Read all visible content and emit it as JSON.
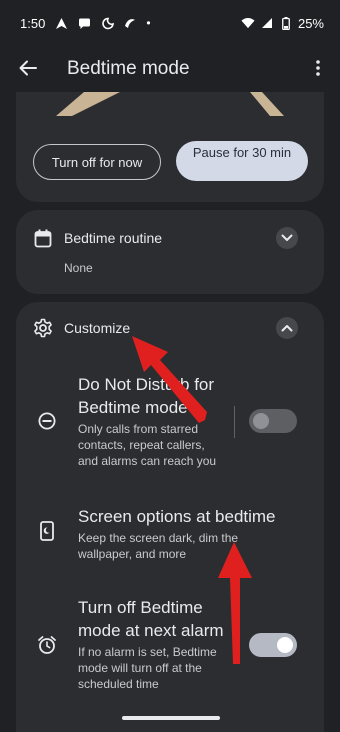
{
  "status_bar": {
    "time": "1:50",
    "dot": "•",
    "battery": "25%"
  },
  "app_bar": {
    "title": "Bedtime mode"
  },
  "top_card": {
    "turn_off_label": "Turn off for now",
    "pause_label": "Pause for 30 min"
  },
  "routine": {
    "title": "Bedtime routine",
    "value": "None"
  },
  "customize": {
    "title": "Customize",
    "items": [
      {
        "title": "Do Not Disturb for Bedtime mode",
        "subtitle": "Only calls from starred contacts, repeat callers, and alarms can reach you",
        "toggle_on": false
      },
      {
        "title": "Screen options at bedtime",
        "subtitle": "Keep the screen dark, dim the wallpaper, and more"
      },
      {
        "title": "Turn off Bedtime mode at next alarm",
        "subtitle": "If no alarm is set, Bedtime mode will turn off at the scheduled time",
        "toggle_on": true
      }
    ]
  },
  "colors": {
    "background": "#202124",
    "card": "#2c2d30",
    "accent_button": "#d3d9e6",
    "annotation_arrow": "#e0201f"
  },
  "icons": {
    "back": "arrow-left-icon",
    "more": "more-vert-icon",
    "routine": "calendar-icon",
    "customize": "gear-icon",
    "dnd": "do-not-disturb-icon",
    "screen": "phone-screen-icon",
    "alarm": "alarm-icon"
  }
}
